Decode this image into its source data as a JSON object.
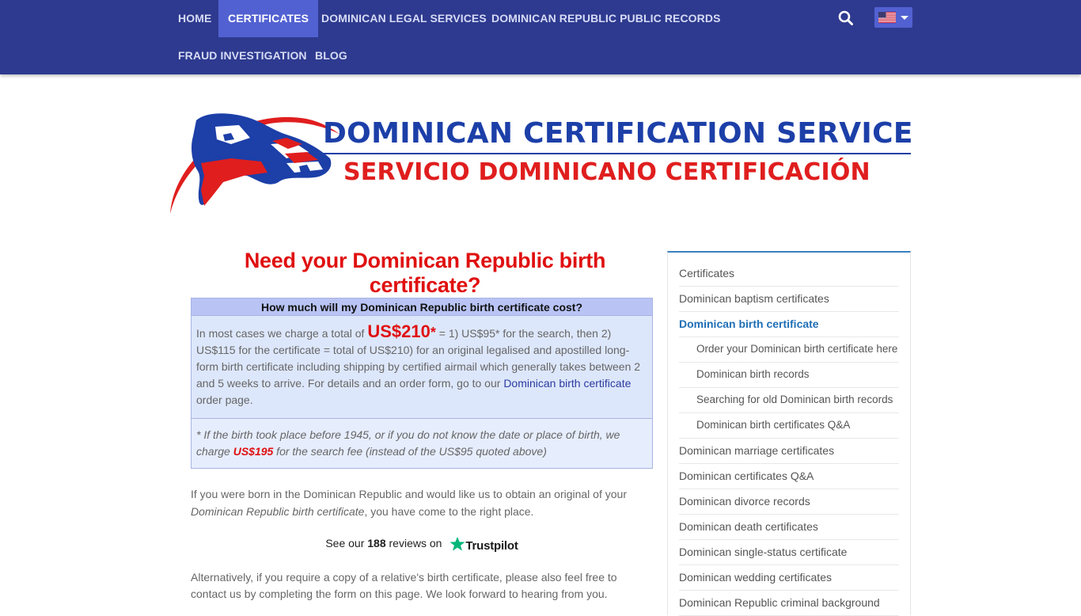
{
  "nav": {
    "items": [
      {
        "label": "HOME"
      },
      {
        "label": "CERTIFICATES"
      },
      {
        "label": "DOMINICAN LEGAL SERVICES"
      },
      {
        "label": "DOMINICAN REPUBLIC PUBLIC RECORDS"
      },
      {
        "label": "FRAUD INVESTIGATION"
      },
      {
        "label": "BLOG"
      }
    ],
    "active_index": 1,
    "search_icon": "search-icon",
    "language_icon": "us-flag-icon"
  },
  "logo": {
    "line1": "DOMINICAN CERTIFICATION SERVICE",
    "line2": "SERVICIO DOMINICANO CERTIFICACIÓN"
  },
  "main": {
    "title": "Need your Dominican Republic birth certificate?",
    "price_box": {
      "heading": "How much will my Dominican Republic birth certificate cost?",
      "intro": "In most cases we charge a total of",
      "price": "US$210",
      "price_star": "*",
      "body_after_price": " = 1) US$95* for the search, then 2) US$115 for the certificate = total of US$210) for an original legalised and apostilled long-form birth certificate including shipping by certified airmail which generally takes between 2 and 5 weeks to arrive. For details and an order form, go to our ",
      "link_text": "Dominican birth certificate",
      "body_end": " order page.",
      "note_before": "* If the birth took place before 1945, or if you do not know the date or place of birth, we charge ",
      "note_price": "US$195",
      "note_after": " for the search fee (instead of the US$95 quoted above)"
    },
    "para1_before": "If you were born in the Dominican Republic and would like us to obtain an original of your ",
    "para1_em": "Dominican Republic birth certificate",
    "para1_after": ", you have come to the right place.",
    "trustpilot": {
      "prefix": "See our ",
      "count": "188",
      "suffix": " reviews on",
      "brand": "Trustpilot"
    },
    "para2": "Alternatively, if you require a copy of a relative's birth certificate, please also feel free to contact us by completing the form on this page. We look forward to hearing from you."
  },
  "sidebar": {
    "items": [
      {
        "label": "Certificates"
      },
      {
        "label": "Dominican baptism certificates"
      },
      {
        "label": "Dominican birth certificate"
      },
      {
        "label": "Order your Dominican birth certificate here"
      },
      {
        "label": "Dominican birth records"
      },
      {
        "label": "Searching for old Dominican birth records"
      },
      {
        "label": "Dominican birth certificates Q&A"
      },
      {
        "label": "Dominican marriage certificates"
      },
      {
        "label": "Dominican certificates Q&A"
      },
      {
        "label": "Dominican divorce records"
      },
      {
        "label": "Dominican death certificates"
      },
      {
        "label": "Dominican single-status certificate"
      },
      {
        "label": "Dominican wedding certificates"
      },
      {
        "label": "Dominican Republic criminal background"
      }
    ],
    "current_index": 2,
    "sub_indices": [
      3,
      4,
      5,
      6
    ]
  },
  "colors": {
    "nav_bg": "#2e3a8f",
    "nav_active": "#5261d1",
    "title_red": "#e01010",
    "link_blue": "#1f6fb5",
    "box_head": "#b9c4f5",
    "box_body": "#dde7fb"
  }
}
